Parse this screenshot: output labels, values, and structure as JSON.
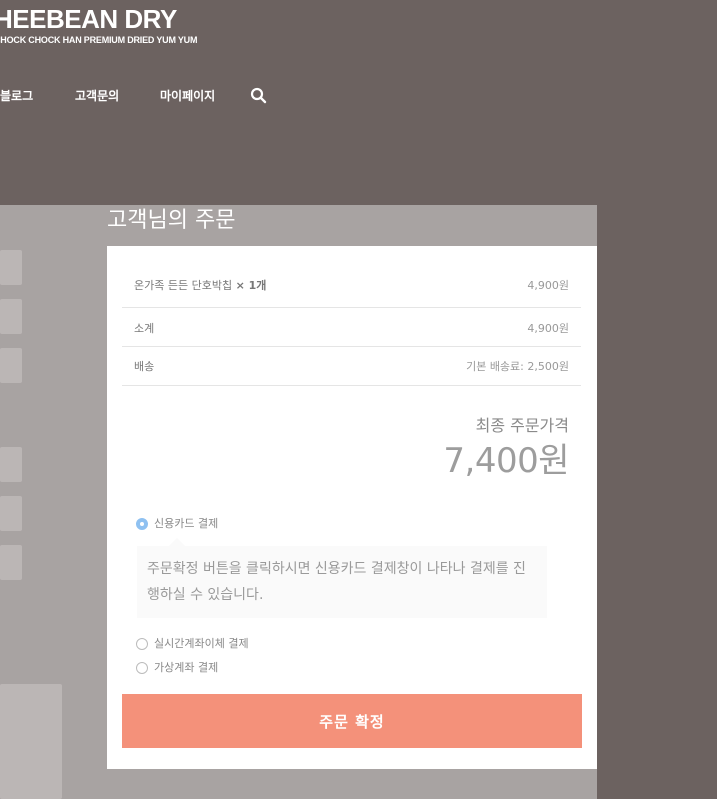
{
  "header": {
    "logo_main": "HEEBEAN DRY",
    "logo_sub": "CHOCK CHOCK HAN PREMIUM DRIED YUM YUM"
  },
  "nav": {
    "items": [
      {
        "label": "블로그"
      },
      {
        "label": "고객문의"
      },
      {
        "label": "마이페이지"
      }
    ],
    "search_icon": "search-icon"
  },
  "order": {
    "title": "고객님의 주문",
    "item": {
      "name": "온가족 든든 단호박칩",
      "qty": "× 1개",
      "price": "4,900원"
    },
    "subtotal": {
      "label": "소계",
      "value": "4,900원"
    },
    "shipping": {
      "label": "배송",
      "value": "기본 배송료: 2,500원"
    },
    "total_label": "최종 주문가격",
    "total_value": "7,400원"
  },
  "payment": {
    "options": [
      {
        "label": "신용카드 결제",
        "selected": true
      },
      {
        "label": "실시간계좌이체 결제",
        "selected": false
      },
      {
        "label": "가상계좌 결제",
        "selected": false
      }
    ],
    "card_description": "주문확정 버튼을 클릭하시면 신용카드 결제창이 나타나 결제를 진행하실 수 있습니다.",
    "confirm_label": "주문 확정"
  },
  "colors": {
    "header_bg": "#6c6260",
    "overlay": "#a8a3a2",
    "accent": "#f4917a",
    "radio_selected": "#8fc1f1"
  }
}
